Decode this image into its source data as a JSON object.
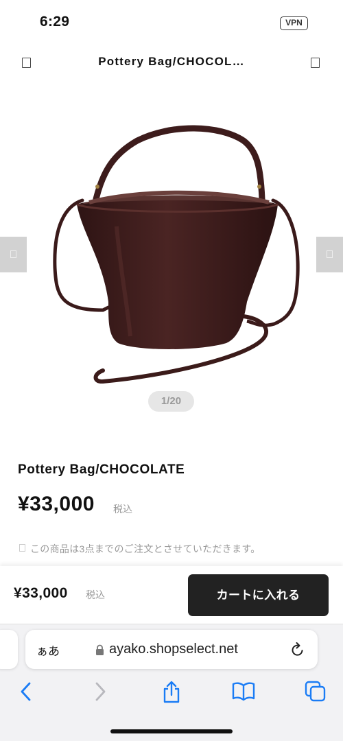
{
  "status_bar": {
    "time": "6:29",
    "vpn": "VPN"
  },
  "header": {
    "title": "Pottery Bag/CHOCOL…"
  },
  "gallery": {
    "counter": "1/20"
  },
  "product": {
    "name": "Pottery Bag/CHOCOLATE",
    "price": "¥33,000",
    "tax_label": "税込",
    "notice": "この商品は3点までのご注文とさせていただきます。"
  },
  "cart_bar": {
    "price": "¥33,000",
    "tax_label": "税込",
    "add_to_cart": "カートに入れる"
  },
  "browser": {
    "aa_label": "ぁあ",
    "url": "ayako.shopselect.net",
    "icons": [
      "back-icon",
      "forward-icon",
      "share-icon",
      "bookmarks-icon",
      "tabs-icon"
    ]
  },
  "colors": {
    "product_brown": "#3d1c1c",
    "cart_button": "#222222",
    "safari_blue": "#1a7cf5"
  }
}
